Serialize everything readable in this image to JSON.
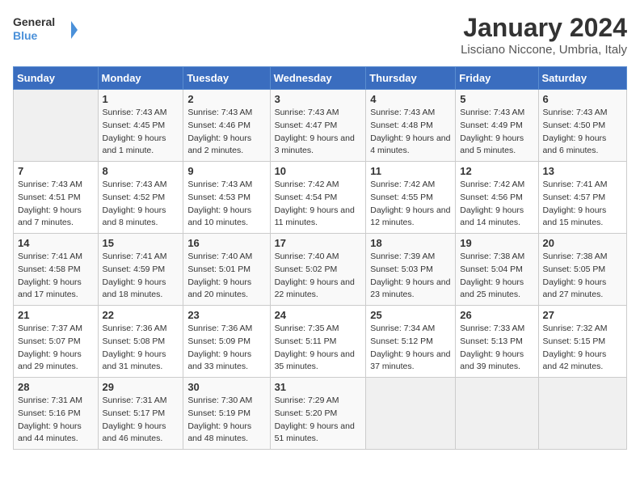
{
  "header": {
    "logo_text_general": "General",
    "logo_text_blue": "Blue",
    "month": "January 2024",
    "location": "Lisciano Niccone, Umbria, Italy"
  },
  "weekdays": [
    "Sunday",
    "Monday",
    "Tuesday",
    "Wednesday",
    "Thursday",
    "Friday",
    "Saturday"
  ],
  "weeks": [
    [
      {
        "day": "",
        "sunrise": "",
        "sunset": "",
        "daylight": ""
      },
      {
        "day": "1",
        "sunrise": "Sunrise: 7:43 AM",
        "sunset": "Sunset: 4:45 PM",
        "daylight": "Daylight: 9 hours and 1 minute."
      },
      {
        "day": "2",
        "sunrise": "Sunrise: 7:43 AM",
        "sunset": "Sunset: 4:46 PM",
        "daylight": "Daylight: 9 hours and 2 minutes."
      },
      {
        "day": "3",
        "sunrise": "Sunrise: 7:43 AM",
        "sunset": "Sunset: 4:47 PM",
        "daylight": "Daylight: 9 hours and 3 minutes."
      },
      {
        "day": "4",
        "sunrise": "Sunrise: 7:43 AM",
        "sunset": "Sunset: 4:48 PM",
        "daylight": "Daylight: 9 hours and 4 minutes."
      },
      {
        "day": "5",
        "sunrise": "Sunrise: 7:43 AM",
        "sunset": "Sunset: 4:49 PM",
        "daylight": "Daylight: 9 hours and 5 minutes."
      },
      {
        "day": "6",
        "sunrise": "Sunrise: 7:43 AM",
        "sunset": "Sunset: 4:50 PM",
        "daylight": "Daylight: 9 hours and 6 minutes."
      }
    ],
    [
      {
        "day": "7",
        "sunrise": "Sunrise: 7:43 AM",
        "sunset": "Sunset: 4:51 PM",
        "daylight": "Daylight: 9 hours and 7 minutes."
      },
      {
        "day": "8",
        "sunrise": "Sunrise: 7:43 AM",
        "sunset": "Sunset: 4:52 PM",
        "daylight": "Daylight: 9 hours and 8 minutes."
      },
      {
        "day": "9",
        "sunrise": "Sunrise: 7:43 AM",
        "sunset": "Sunset: 4:53 PM",
        "daylight": "Daylight: 9 hours and 10 minutes."
      },
      {
        "day": "10",
        "sunrise": "Sunrise: 7:42 AM",
        "sunset": "Sunset: 4:54 PM",
        "daylight": "Daylight: 9 hours and 11 minutes."
      },
      {
        "day": "11",
        "sunrise": "Sunrise: 7:42 AM",
        "sunset": "Sunset: 4:55 PM",
        "daylight": "Daylight: 9 hours and 12 minutes."
      },
      {
        "day": "12",
        "sunrise": "Sunrise: 7:42 AM",
        "sunset": "Sunset: 4:56 PM",
        "daylight": "Daylight: 9 hours and 14 minutes."
      },
      {
        "day": "13",
        "sunrise": "Sunrise: 7:41 AM",
        "sunset": "Sunset: 4:57 PM",
        "daylight": "Daylight: 9 hours and 15 minutes."
      }
    ],
    [
      {
        "day": "14",
        "sunrise": "Sunrise: 7:41 AM",
        "sunset": "Sunset: 4:58 PM",
        "daylight": "Daylight: 9 hours and 17 minutes."
      },
      {
        "day": "15",
        "sunrise": "Sunrise: 7:41 AM",
        "sunset": "Sunset: 4:59 PM",
        "daylight": "Daylight: 9 hours and 18 minutes."
      },
      {
        "day": "16",
        "sunrise": "Sunrise: 7:40 AM",
        "sunset": "Sunset: 5:01 PM",
        "daylight": "Daylight: 9 hours and 20 minutes."
      },
      {
        "day": "17",
        "sunrise": "Sunrise: 7:40 AM",
        "sunset": "Sunset: 5:02 PM",
        "daylight": "Daylight: 9 hours and 22 minutes."
      },
      {
        "day": "18",
        "sunrise": "Sunrise: 7:39 AM",
        "sunset": "Sunset: 5:03 PM",
        "daylight": "Daylight: 9 hours and 23 minutes."
      },
      {
        "day": "19",
        "sunrise": "Sunrise: 7:38 AM",
        "sunset": "Sunset: 5:04 PM",
        "daylight": "Daylight: 9 hours and 25 minutes."
      },
      {
        "day": "20",
        "sunrise": "Sunrise: 7:38 AM",
        "sunset": "Sunset: 5:05 PM",
        "daylight": "Daylight: 9 hours and 27 minutes."
      }
    ],
    [
      {
        "day": "21",
        "sunrise": "Sunrise: 7:37 AM",
        "sunset": "Sunset: 5:07 PM",
        "daylight": "Daylight: 9 hours and 29 minutes."
      },
      {
        "day": "22",
        "sunrise": "Sunrise: 7:36 AM",
        "sunset": "Sunset: 5:08 PM",
        "daylight": "Daylight: 9 hours and 31 minutes."
      },
      {
        "day": "23",
        "sunrise": "Sunrise: 7:36 AM",
        "sunset": "Sunset: 5:09 PM",
        "daylight": "Daylight: 9 hours and 33 minutes."
      },
      {
        "day": "24",
        "sunrise": "Sunrise: 7:35 AM",
        "sunset": "Sunset: 5:11 PM",
        "daylight": "Daylight: 9 hours and 35 minutes."
      },
      {
        "day": "25",
        "sunrise": "Sunrise: 7:34 AM",
        "sunset": "Sunset: 5:12 PM",
        "daylight": "Daylight: 9 hours and 37 minutes."
      },
      {
        "day": "26",
        "sunrise": "Sunrise: 7:33 AM",
        "sunset": "Sunset: 5:13 PM",
        "daylight": "Daylight: 9 hours and 39 minutes."
      },
      {
        "day": "27",
        "sunrise": "Sunrise: 7:32 AM",
        "sunset": "Sunset: 5:15 PM",
        "daylight": "Daylight: 9 hours and 42 minutes."
      }
    ],
    [
      {
        "day": "28",
        "sunrise": "Sunrise: 7:31 AM",
        "sunset": "Sunset: 5:16 PM",
        "daylight": "Daylight: 9 hours and 44 minutes."
      },
      {
        "day": "29",
        "sunrise": "Sunrise: 7:31 AM",
        "sunset": "Sunset: 5:17 PM",
        "daylight": "Daylight: 9 hours and 46 minutes."
      },
      {
        "day": "30",
        "sunrise": "Sunrise: 7:30 AM",
        "sunset": "Sunset: 5:19 PM",
        "daylight": "Daylight: 9 hours and 48 minutes."
      },
      {
        "day": "31",
        "sunrise": "Sunrise: 7:29 AM",
        "sunset": "Sunset: 5:20 PM",
        "daylight": "Daylight: 9 hours and 51 minutes."
      },
      {
        "day": "",
        "sunrise": "",
        "sunset": "",
        "daylight": ""
      },
      {
        "day": "",
        "sunrise": "",
        "sunset": "",
        "daylight": ""
      },
      {
        "day": "",
        "sunrise": "",
        "sunset": "",
        "daylight": ""
      }
    ]
  ]
}
